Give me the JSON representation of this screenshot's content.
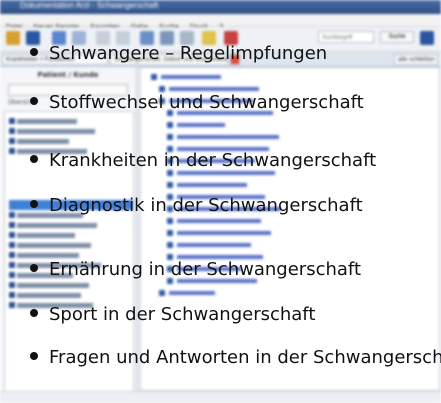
{
  "app": {
    "title": "Dokumentation Arzt - Schwangerschaft",
    "menu": [
      "Datei",
      "Neues Fenster",
      "Favoriten",
      "Gehe",
      "Suche",
      "Druck",
      "?"
    ],
    "search": {
      "placeholder": "Suchbegriff",
      "button": "Suche"
    },
    "tabs": [
      "Krankheiten > Funktionen",
      "Schwangerschaft, Geburt und Wochenbett"
    ],
    "close_tabs_button": "alle schließen",
    "left_panel": {
      "header": "Patient / Kunde",
      "filter_label": "Übersicht"
    }
  },
  "overlay": {
    "items": [
      "Schwangere – Regelimpfungen",
      "Stoffwechsel und Schwangerschaft",
      "Krankheiten in der Schwangerschaft",
      "Diagnostik in der Schwangerschaft",
      "Ernährung in der Schwangerschaft",
      "Sport in der Schwangerschaft",
      "Fragen und Antworten in der Schwangerschaft"
    ]
  },
  "colors": {
    "accent": "#3f7fd6",
    "link": "#5872c8",
    "text": "#111111"
  }
}
